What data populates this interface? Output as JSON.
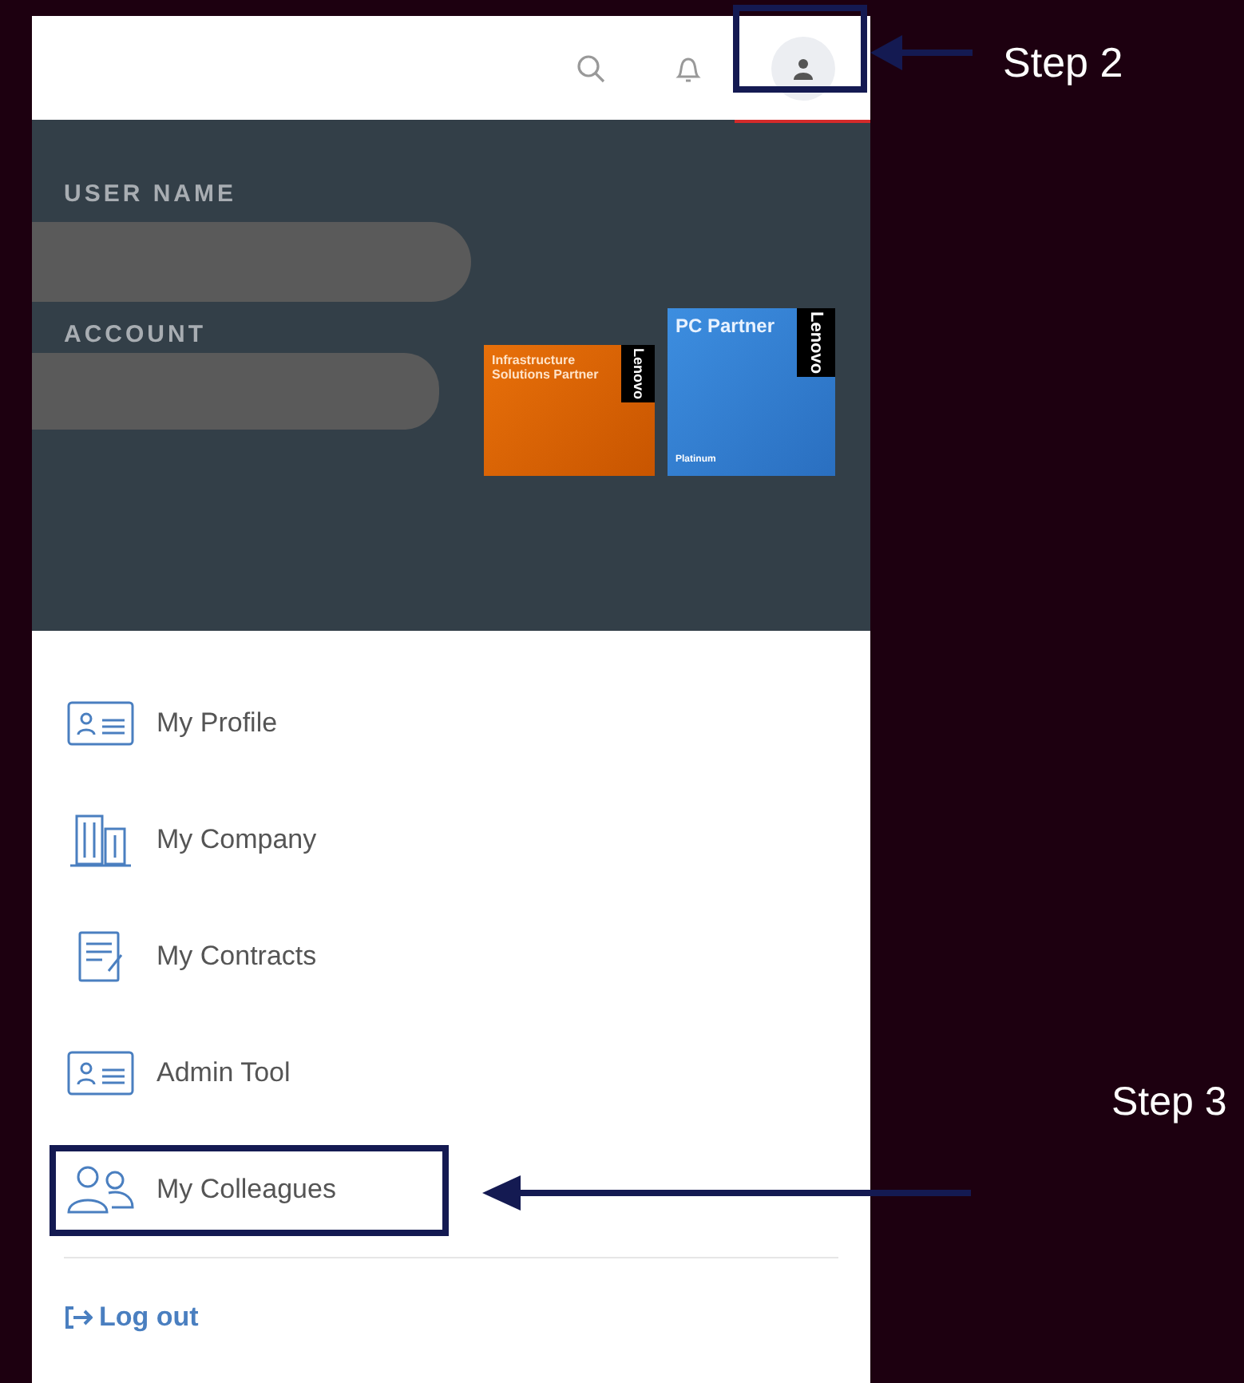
{
  "profile": {
    "user_label": "USER NAME",
    "account_label": "ACCOUNT"
  },
  "badges": [
    {
      "kind": "orange",
      "title": "Infrastructure Solutions Partner",
      "brand": "Lenovo"
    },
    {
      "kind": "blue",
      "title": "PC Partner",
      "brand": "Lenovo",
      "tier": "Platinum"
    }
  ],
  "menu": [
    {
      "kind": "id-card",
      "label": "My Profile"
    },
    {
      "kind": "building",
      "label": "My Company"
    },
    {
      "kind": "contract",
      "label": "My Contracts"
    },
    {
      "kind": "id-card",
      "label": "Admin Tool"
    },
    {
      "kind": "people",
      "label": "My Colleagues"
    }
  ],
  "logout": "Log out",
  "annotations": [
    {
      "label": "Step 2"
    },
    {
      "label": "Step 3"
    }
  ]
}
